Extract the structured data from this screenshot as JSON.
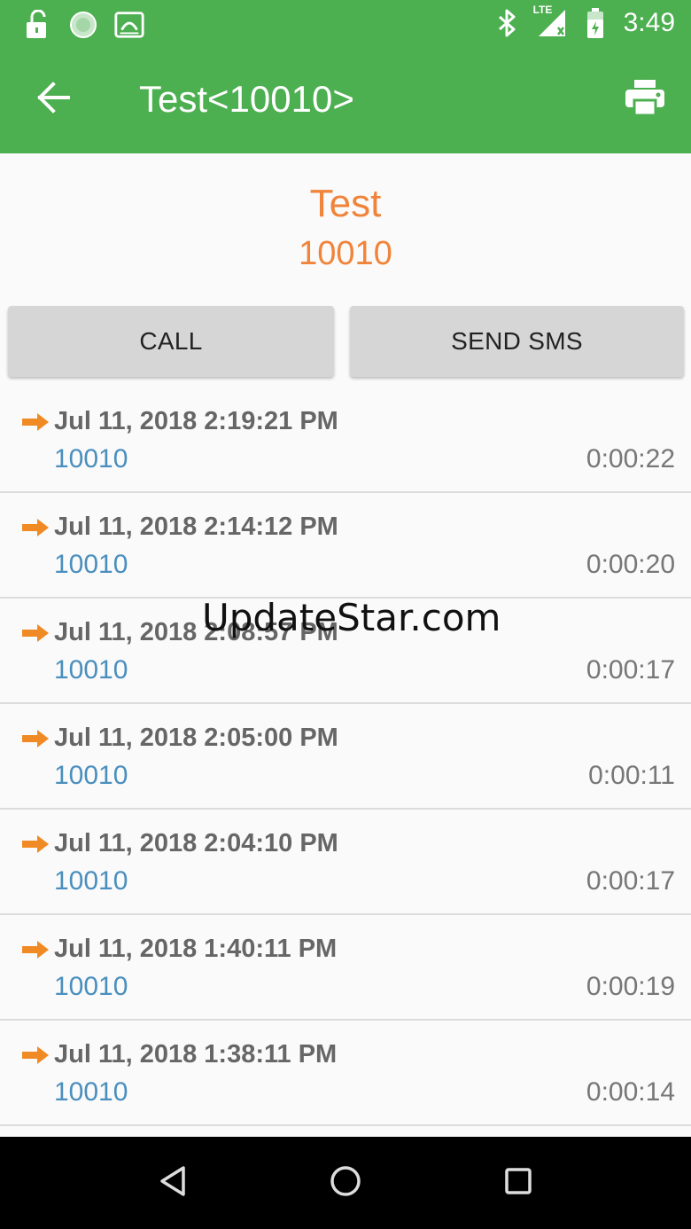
{
  "status_bar": {
    "time": "3:49",
    "network_label": "LTE",
    "icons": [
      "lock-open-icon",
      "sync-icon",
      "drive-icon",
      "bluetooth-icon",
      "signal-icon",
      "battery-icon"
    ]
  },
  "toolbar": {
    "title": "Test<10010>",
    "back_icon": "arrow-back-icon",
    "print_icon": "print-icon"
  },
  "contact": {
    "name": "Test",
    "number": "10010"
  },
  "actions": {
    "call_label": "CALL",
    "sms_label": "SEND SMS"
  },
  "calls": [
    {
      "date": "Jul 11, 2018 2:19:21 PM",
      "number": "10010",
      "duration": "0:00:22"
    },
    {
      "date": "Jul 11, 2018 2:14:12 PM",
      "number": "10010",
      "duration": "0:00:20"
    },
    {
      "date": "Jul 11, 2018 2:08:57 PM",
      "number": "10010",
      "duration": "0:00:17"
    },
    {
      "date": "Jul 11, 2018 2:05:00 PM",
      "number": "10010",
      "duration": "0:00:11"
    },
    {
      "date": "Jul 11, 2018 2:04:10 PM",
      "number": "10010",
      "duration": "0:00:17"
    },
    {
      "date": "Jul 11, 2018 1:40:11 PM",
      "number": "10010",
      "duration": "0:00:19"
    },
    {
      "date": "Jul 11, 2018 1:38:11 PM",
      "number": "10010",
      "duration": "0:00:14"
    }
  ],
  "watermark": "UpdateStar.com",
  "colors": {
    "app_bar": "#4caf50",
    "accent_orange": "#f0843a",
    "number_blue": "#4a8fbd"
  }
}
